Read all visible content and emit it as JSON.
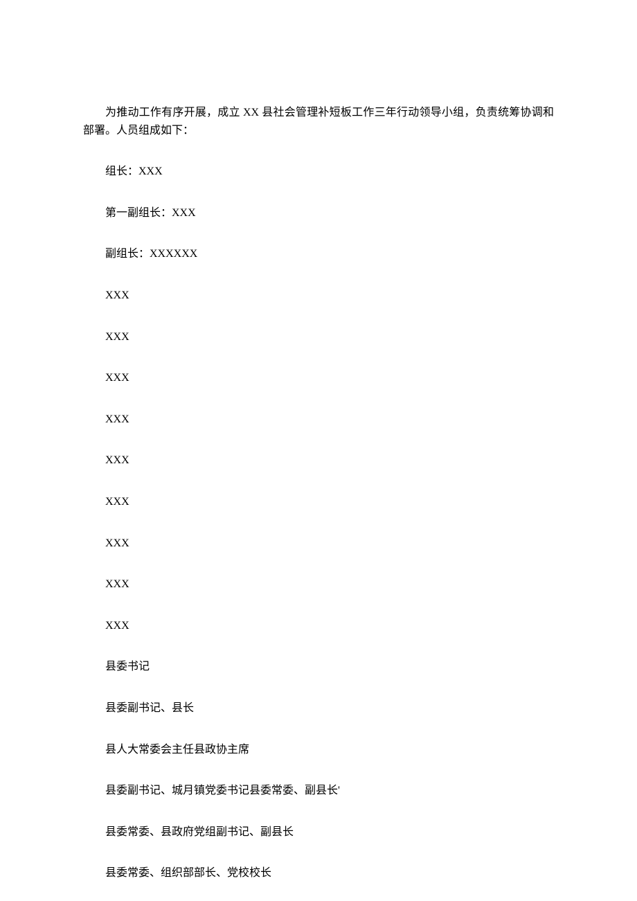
{
  "intro": "为推动工作有序开展，成立 XX 县社会管理补短板工作三年行动领导小组，负责统筹协调和部署。人员组成如下：",
  "lines": [
    "组长：XXX",
    "第一副组长：XXX",
    "副组长：XXXXXX",
    "XXX",
    "XXX",
    "XXX",
    "XXX",
    "XXX",
    "XXX",
    "XXX",
    "XXX",
    "XXX",
    "县委书记",
    "县委副书记、县长",
    "县人大常委会主任县政协主席",
    "县委副书记、城月镇党委书记县委常委、副县长'",
    "县委常委、县政府党组副书记、副县长",
    "县委常委、组织部部长、党校校长"
  ]
}
